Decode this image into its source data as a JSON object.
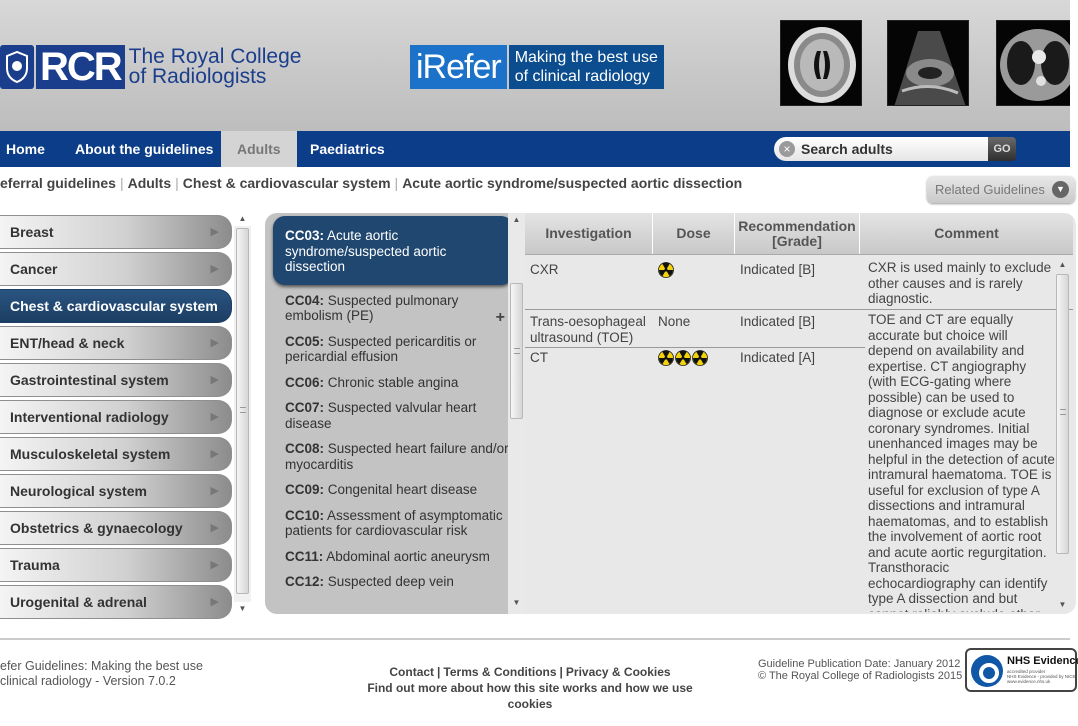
{
  "header": {
    "rcr_short": "RCR",
    "rcr_name_line1": "The Royal College",
    "rcr_name_line2": "of Radiologists",
    "irefer_word": "iRefer",
    "irefer_tag_line1": "Making the best use",
    "irefer_tag_line2": "of clinical radiology"
  },
  "nav": {
    "items": [
      {
        "label": "Home"
      },
      {
        "label": "About the guidelines"
      },
      {
        "label": "Adults"
      },
      {
        "label": "Paediatrics"
      }
    ],
    "active": "Adults",
    "search_placeholder": "Search adults",
    "search_go": "GO"
  },
  "breadcrumb": {
    "items": [
      "eferral guidelines",
      "Adults",
      "Chest & cardiovascular system",
      "Acute aortic syndrome/suspected aortic dissection"
    ],
    "related_label": "Related Guidelines"
  },
  "systems": [
    {
      "label": "Breast",
      "active": false
    },
    {
      "label": "Cancer",
      "active": false
    },
    {
      "label": "Chest & cardiovascular system",
      "active": true
    },
    {
      "label": "ENT/head & neck",
      "active": false
    },
    {
      "label": "Gastrointestinal system",
      "active": false
    },
    {
      "label": "Interventional radiology",
      "active": false
    },
    {
      "label": "Musculoskeletal system",
      "active": false
    },
    {
      "label": "Neurological system",
      "active": false
    },
    {
      "label": "Obstetrics & gynaecology",
      "active": false
    },
    {
      "label": "Trauma",
      "active": false
    },
    {
      "label": "Urogenital & adrenal",
      "active": false
    }
  ],
  "topics": [
    {
      "code": "CC03:",
      "name": " Acute aortic syndrome/suspected aortic dissection",
      "active": true
    },
    {
      "code": "CC04:",
      "name": " Suspected pulmonary embolism (PE)",
      "active": false
    },
    {
      "code": "CC05:",
      "name": " Suspected pericarditis or pericardial effusion",
      "active": false
    },
    {
      "code": "CC06:",
      "name": " Chronic stable angina",
      "active": false
    },
    {
      "code": "CC07:",
      "name": " Suspected valvular heart disease",
      "active": false
    },
    {
      "code": "CC08:",
      "name": " Suspected heart failure and/or myocarditis",
      "active": false
    },
    {
      "code": "CC09:",
      "name": " Congenital heart disease",
      "active": false
    },
    {
      "code": "CC10:",
      "name": " Assessment of asymptomatic patients for cardiovascular risk",
      "active": false
    },
    {
      "code": "CC11:",
      "name": " Abdominal aortic aneurysm",
      "active": false
    },
    {
      "code": "CC12:",
      "name": " Suspected deep vein",
      "active": false
    }
  ],
  "topic_plus": "+",
  "table": {
    "headers": {
      "investigation": "Investigation",
      "dose": "Dose",
      "recommendation_line1": "Recommendation",
      "recommendation_line2": "[Grade]",
      "comment": "Comment"
    },
    "rows": [
      {
        "investigation": "CXR",
        "dose_symbols": 1,
        "dose_text": "",
        "recommendation": "Indicated [B]"
      },
      {
        "investigation": "Trans-oesophageal ultrasound (TOE)",
        "dose_symbols": 0,
        "dose_text": "None",
        "recommendation": "Indicated [B]"
      },
      {
        "investigation": "CT",
        "dose_symbols": 3,
        "dose_text": "",
        "recommendation": "Indicated [A]"
      }
    ],
    "comment_1": "CXR is used mainly to exclude other causes and is rarely diagnostic.",
    "comment_2": "TOE and CT are equally accurate but choice will depend on availability and expertise. CT angiography (with ECG-gating where possible) can be used to diagnose or exclude acute coronary syndromes. Initial unenhanced images may be helpful in the detection of acute intramural haematoma. TOE is useful for exclusion of type A dissections and intramural haematomas, and to establish the involvement of aortic root and acute aortic regurgitation. Transthoracic echocardiography can identify type A dissection and but cannot reliably exclude other causes of acute aortic"
  },
  "footer": {
    "left_line1": "efer Guidelines: Making the best use",
    "left_line2": " clinical radiology - Version 7.0.2",
    "contact": "Contact",
    "terms": "Terms & Conditions",
    "privacy": "Privacy & Cookies",
    "find_out": "Find out more about how this site works and how we use cookies",
    "publication": "Guideline Publication Date: January 2012",
    "copyright": "© The Royal College of Radiologists 2015",
    "nhs_title": "NHS Evidence",
    "nhs_sub1": "accredited provider",
    "nhs_sub2": "NHS Evidence - provided by NICE",
    "nhs_sub3": "www.evidence.nhs.uk"
  },
  "colors": {
    "navy": "#0c3d88",
    "active_blue": "#1f4770",
    "rcr_blue": "#1b3e8c",
    "irefer_blue": "#1b72c8"
  }
}
